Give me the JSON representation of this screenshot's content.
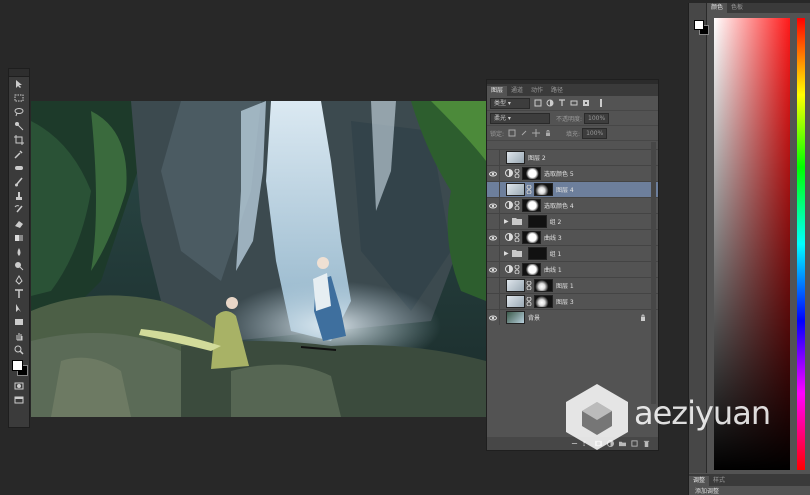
{
  "layers_panel": {
    "tabs": [
      "图层",
      "通道",
      "动作",
      "路径"
    ],
    "filter_kind": "类型",
    "blend_mode": "柔光",
    "opacity_label": "不透明度:",
    "opacity_value": "100%",
    "lock_label": "锁定:",
    "fill_label": "填充:",
    "fill_value": "100%",
    "layers": [
      {
        "name": "图层 2",
        "visible": false,
        "type": "pixel",
        "selected": false
      },
      {
        "name": "选取颜色 5",
        "visible": true,
        "type": "adjustment",
        "selected": false
      },
      {
        "name": "图层 4",
        "visible": false,
        "type": "pixel",
        "selected": true
      },
      {
        "name": "选取颜色 4",
        "visible": true,
        "type": "adjustment",
        "selected": false
      },
      {
        "name": "组 2",
        "visible": false,
        "type": "group",
        "selected": false
      },
      {
        "name": "曲线 3",
        "visible": true,
        "type": "adjustment",
        "selected": false
      },
      {
        "name": "组 1",
        "visible": false,
        "type": "group",
        "selected": false
      },
      {
        "name": "曲线 1",
        "visible": true,
        "type": "adjustment",
        "selected": false
      },
      {
        "name": "图层 1",
        "visible": false,
        "type": "pixel",
        "selected": false
      },
      {
        "name": "图层 3",
        "visible": false,
        "type": "pixel",
        "selected": false
      },
      {
        "name": "背景",
        "visible": true,
        "type": "background",
        "selected": false
      }
    ]
  },
  "color_panel": {
    "tabs": [
      "颜色",
      "色板"
    ],
    "bottom_tabs": [
      "调整",
      "样式"
    ],
    "bottom_label": "添加调整"
  },
  "watermark": {
    "text": "aeziyuan"
  },
  "toolbar": {
    "tools": [
      "move-tool",
      "marquee-tool",
      "lasso-tool",
      "quick-select-tool",
      "crop-tool",
      "eyedropper-tool",
      "healing-tool",
      "brush-tool",
      "clone-stamp-tool",
      "history-brush-tool",
      "eraser-tool",
      "gradient-tool",
      "blur-tool",
      "dodge-tool",
      "pen-tool",
      "type-tool",
      "path-select-tool",
      "rectangle-tool",
      "hand-tool",
      "zoom-tool"
    ]
  }
}
